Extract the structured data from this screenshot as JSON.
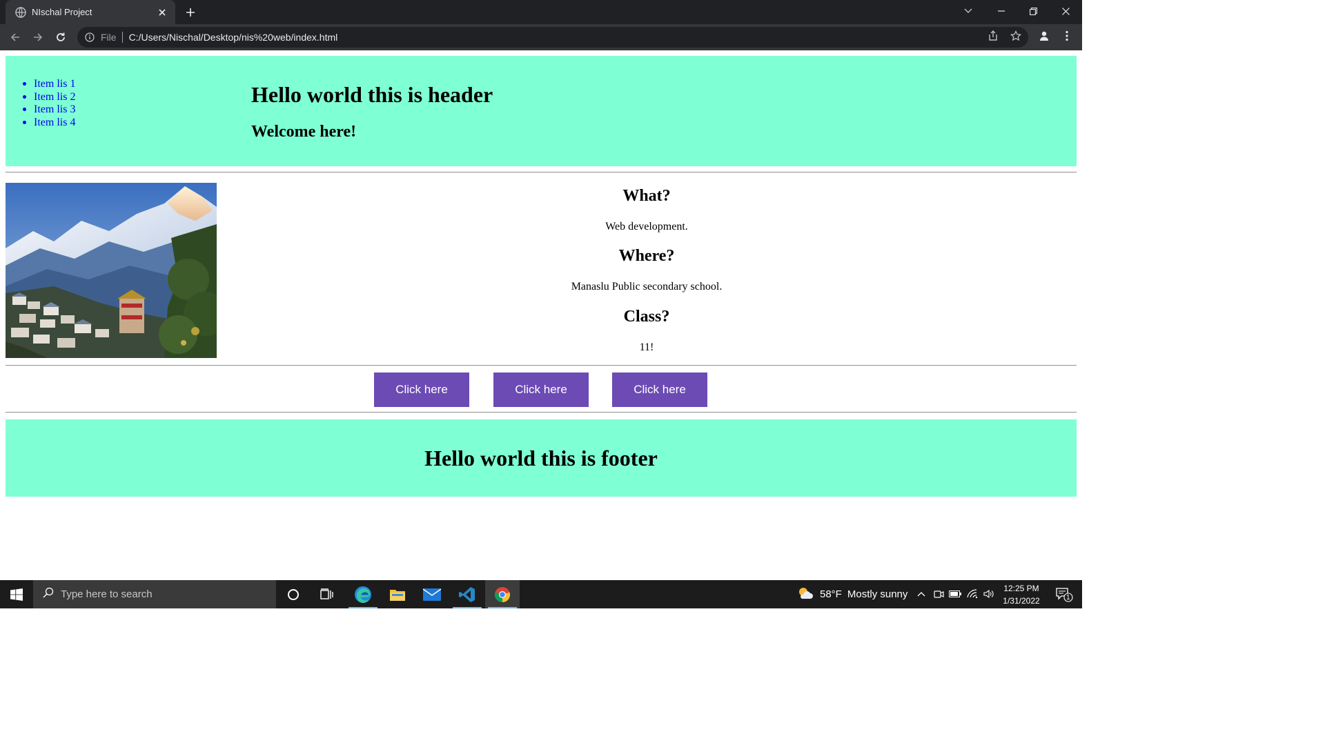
{
  "browser": {
    "tab_title": "NIschal Project",
    "omnibox": {
      "scheme": "File",
      "url": "C:/Users/Nischal/Desktop/nis%20web/index.html"
    }
  },
  "page": {
    "nav_items": [
      "Item lis 1",
      "Item lis 2",
      "Item lis 3",
      "Item lis 4"
    ],
    "header_title": "Hello world this is header",
    "header_subtitle": "Welcome here!",
    "info": [
      {
        "question": "What?",
        "answer": "Web development."
      },
      {
        "question": "Where?",
        "answer": "Manaslu Public secondary school."
      },
      {
        "question": "Class?",
        "answer": "11!"
      }
    ],
    "buttons": [
      "Click here",
      "Click here",
      "Click here"
    ],
    "footer_title": "Hello world this is footer",
    "colors": {
      "header_bg": "#7fffd4",
      "footer_bg": "#7fffd4",
      "button_bg": "#6c4bb4",
      "link": "#0000ee"
    }
  },
  "taskbar": {
    "search_placeholder": "Type here to search",
    "weather_temp": "58°F",
    "weather_text": "Mostly sunny",
    "time": "12:25 PM",
    "date": "1/31/2022",
    "notification_count": "1"
  }
}
